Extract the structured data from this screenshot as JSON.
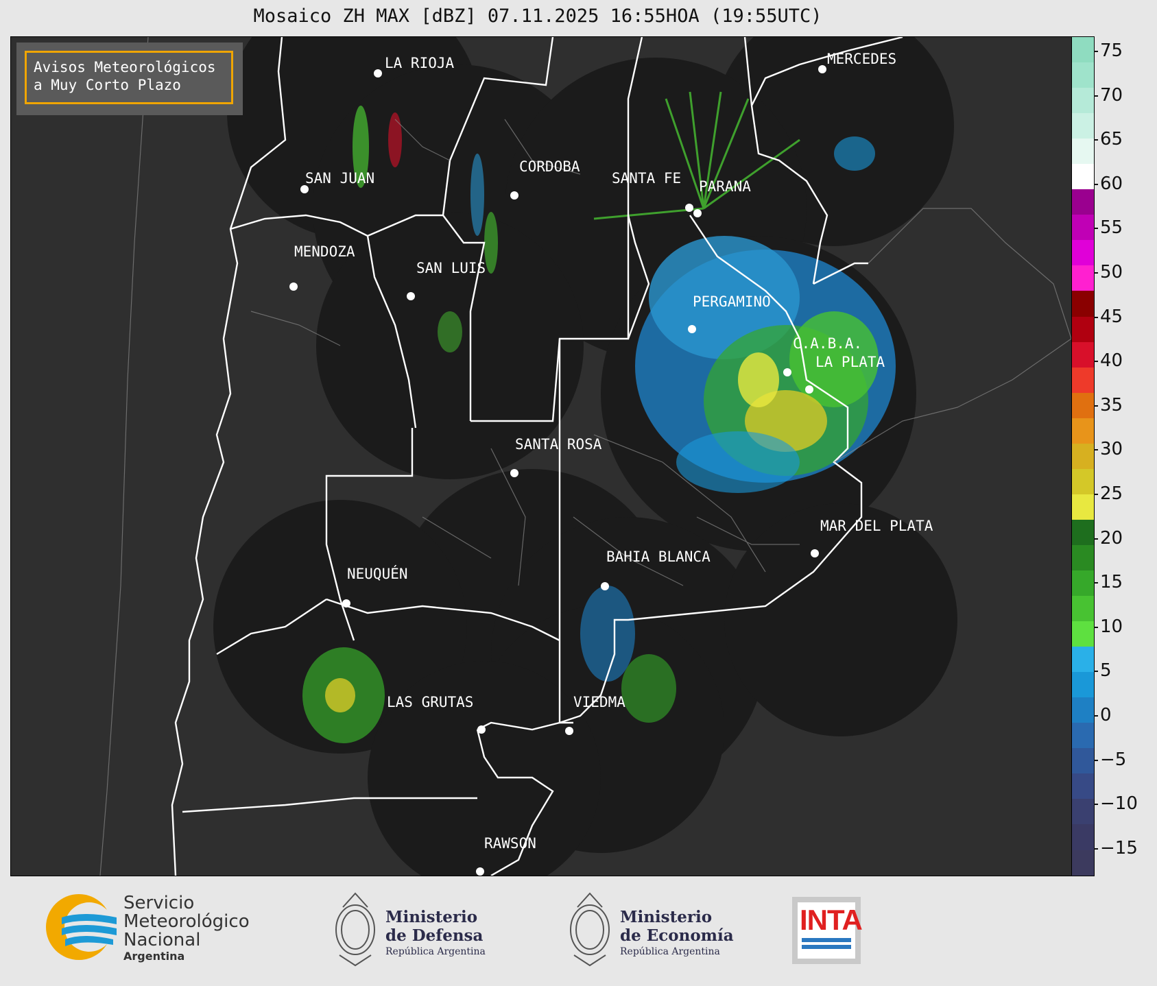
{
  "title": "Mosaico ZH MAX [dBZ] 07.11.2025 16:55HOA (19:55UTC)",
  "avisos": {
    "line1": "Avisos Meteorológicos",
    "line2": "a Muy Corto Plazo"
  },
  "cities": [
    {
      "name": "LA RIOJA"
    },
    {
      "name": "MERCEDES"
    },
    {
      "name": "SAN JUAN"
    },
    {
      "name": "CORDOBA"
    },
    {
      "name": "SANTA FE"
    },
    {
      "name": "PARANA"
    },
    {
      "name": "MENDOZA"
    },
    {
      "name": "SAN LUIS"
    },
    {
      "name": "PERGAMINO"
    },
    {
      "name": "C.A.B.A."
    },
    {
      "name": "LA PLATA"
    },
    {
      "name": "SANTA ROSA"
    },
    {
      "name": "MAR DEL PLATA"
    },
    {
      "name": "BAHIA BLANCA"
    },
    {
      "name": "NEUQUÉN"
    },
    {
      "name": "LAS GRUTAS"
    },
    {
      "name": "VIEDMA"
    },
    {
      "name": "RAWSON"
    }
  ],
  "colorbar": {
    "unit": "dBZ",
    "ticks": [
      "75",
      "70",
      "65",
      "60",
      "55",
      "50",
      "45",
      "40",
      "35",
      "30",
      "25",
      "20",
      "15",
      "10",
      "5",
      "0",
      "−5",
      "−10",
      "−15"
    ],
    "colors": [
      "#8fdcc0",
      "#9fe3cb",
      "#b5ead8",
      "#cbf1e4",
      "#e6f8f1",
      "#ffffff",
      "#9a008f",
      "#c000b5",
      "#e000d8",
      "#ff20d0",
      "#8a0000",
      "#b00010",
      "#d8102a",
      "#ee3a2a",
      "#e07010",
      "#e8941a",
      "#d7b020",
      "#d4c828",
      "#e8e840",
      "#1e6e1e",
      "#2a8a22",
      "#36a82a",
      "#48c232",
      "#5ee040",
      "#2ab0e8",
      "#1a98d8",
      "#1e80c4",
      "#2a6ab0",
      "#30589a",
      "#374a86",
      "#3a4070",
      "#3a3a64",
      "#3c3a5e"
    ]
  },
  "logos": {
    "smn": {
      "line1": "Servicio",
      "line2": "Meteorológico",
      "line3": "Nacional",
      "line4": "Argentina"
    },
    "defensa": {
      "line1": "Ministerio",
      "line2": "de Defensa",
      "line3": "República Argentina"
    },
    "economia": {
      "line1": "Ministerio",
      "line2": "de Economía",
      "line3": "República Argentina"
    },
    "inta": {
      "text": "INTA"
    }
  }
}
